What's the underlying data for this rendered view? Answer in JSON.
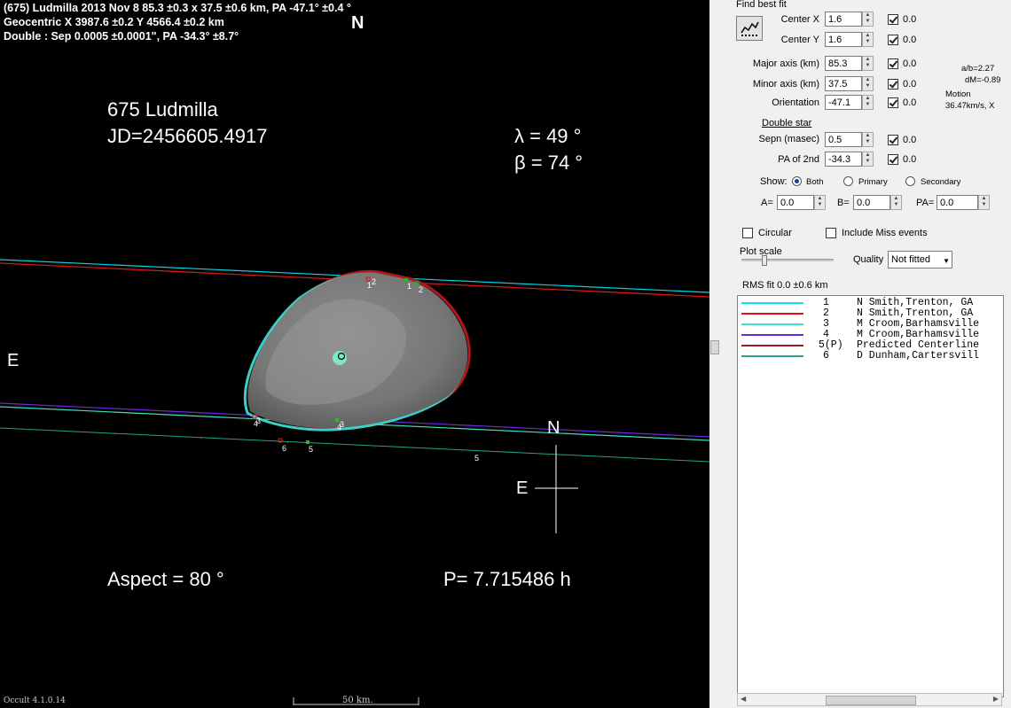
{
  "header": {
    "line1": "(675) Ludmilla  2013 Nov 8  85.3 ±0.3 x 37.5 ±0.6 km, PA -47.1° ±0.4 °",
    "line2": "Geocentric  X  3987.6 ±0.2  Y 4566.4 ±0.2 km",
    "line3": "Double : Sep  0.0005 ±0.0001\", PA -34.3° ±8.7°"
  },
  "plot": {
    "top_north": "N",
    "asteroid_name": "675 Ludmilla",
    "jd": "JD=2456605.4917",
    "lambda": "λ =   49 °",
    "beta": "β =   74 °",
    "east_left": "E",
    "compass_n": "N",
    "compass_e": "E",
    "aspect": "Aspect = 80 °",
    "period": "P= 7.715486 h",
    "scale_label": "50 km.",
    "version": "Occult 4.1.0.14",
    "chord_labels": [
      "1",
      "2",
      "1",
      "2",
      "4",
      "3",
      "4",
      "3",
      "6",
      "5",
      "5"
    ]
  },
  "panel": {
    "find_best_fit": "Find best fit",
    "center_x": {
      "label": "Center X",
      "value": "1.6",
      "unc": "0.0"
    },
    "center_y": {
      "label": "Center Y",
      "value": "1.6",
      "unc": "0.0"
    },
    "major_axis": {
      "label": "Major axis (km)",
      "value": "85.3",
      "unc": "0.0"
    },
    "minor_axis": {
      "label": "Minor axis (km)",
      "value": "37.5",
      "unc": "0.0"
    },
    "orientation": {
      "label": "Orientation",
      "value": "-47.1",
      "unc": "0.0"
    },
    "ab_ratio": "a/b=2.27",
    "dm": "dM=-0.89",
    "motion_label": "Motion",
    "motion_value": "36.47km/s, X",
    "double_star": "Double star",
    "sepn": {
      "label": "Sepn (masec)",
      "value": "0.5",
      "unc": "0.0"
    },
    "pa2": {
      "label": "PA of 2nd",
      "value": "-34.3",
      "unc": "0.0"
    },
    "show_label": "Show:",
    "show_both": "Both",
    "show_primary": "Primary",
    "show_secondary": "Secondary",
    "a_label": "A=",
    "a_value": "0.0",
    "b_label": "B=",
    "b_value": "0.0",
    "pa_label": "PA=",
    "pa_value": "0.0",
    "circular": "Circular",
    "include_miss": "Include Miss events",
    "plot_scale": "Plot scale",
    "quality_label": "Quality",
    "quality_value": "Not fitted",
    "rms": "RMS fit 0.0 ±0.6 km"
  },
  "observers": [
    {
      "num": "1",
      "name": "N Smith,Trenton, GA",
      "color": "#00e5ee"
    },
    {
      "num": "2",
      "name": "N Smith,Trenton, GA",
      "color": "#e81010"
    },
    {
      "num": "3",
      "name": "M Croom,Barhamsville",
      "color": "#40e0c0"
    },
    {
      "num": "4",
      "name": "M Croom,Barhamsville",
      "color": "#6a2ae0"
    },
    {
      "num": "5(P)",
      "name": "Predicted Centerline",
      "color": "#a01818"
    },
    {
      "num": "6",
      "name": "D Dunham,Cartersvill",
      "color": "#2aa090"
    }
  ]
}
